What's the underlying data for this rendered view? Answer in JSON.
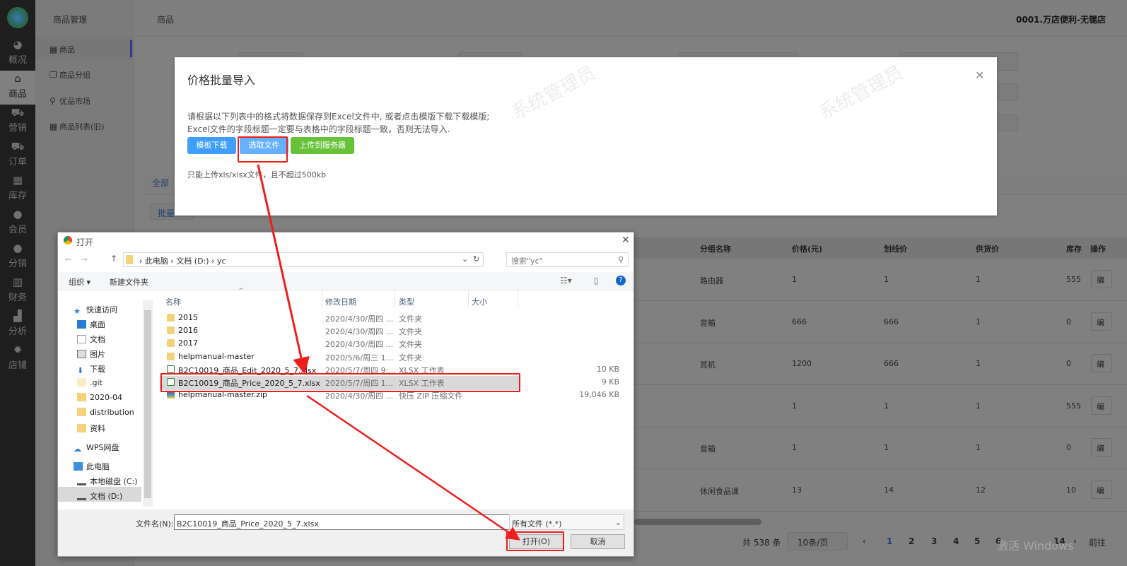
{
  "sidebar": {
    "items": [
      {
        "label": "概况",
        "icon": "dashboard-icon"
      },
      {
        "label": "商品",
        "icon": "goods-icon"
      },
      {
        "label": "营销",
        "icon": "cart-icon"
      },
      {
        "label": "订单",
        "icon": "cart-icon"
      },
      {
        "label": "库存",
        "icon": "grid-icon"
      },
      {
        "label": "会员",
        "icon": "user-icon"
      },
      {
        "label": "分销",
        "icon": "user-share-icon"
      },
      {
        "label": "财务",
        "icon": "finance-icon"
      },
      {
        "label": "分析",
        "icon": "chart-icon"
      },
      {
        "label": "店铺",
        "icon": "gear-icon"
      }
    ]
  },
  "submenu": {
    "title": "商品管理",
    "items": [
      "商品",
      "商品分组",
      "优品市场",
      "商品列表(旧)"
    ]
  },
  "header": {
    "breadcrumb": "商品",
    "store": "0001.万店便利-无锡店"
  },
  "tabs": {
    "all": "全部",
    "batch": "批量"
  },
  "table": {
    "headers": [
      "分组名称",
      "价格(元)",
      "划线价",
      "供货价",
      "库存",
      "操作"
    ],
    "rows": [
      [
        "路由器",
        "1",
        "1",
        "1",
        "555",
        "编"
      ],
      [
        "音箱",
        "666",
        "666",
        "1",
        "0",
        "编"
      ],
      [
        "耳机",
        "1200",
        "666",
        "1",
        "0",
        "编"
      ],
      [
        "",
        "1",
        "1",
        "1",
        "555",
        "编"
      ],
      [
        "音箱",
        "1",
        "1",
        "1",
        "0",
        "编"
      ],
      [
        "休闲食品课",
        "13",
        "14",
        "12",
        "10",
        "编"
      ]
    ]
  },
  "pagination": {
    "total": "共 538 条",
    "page_size": "10条/页",
    "pages": [
      "1",
      "2",
      "3",
      "4",
      "5",
      "6",
      "14"
    ],
    "goto": "前往",
    "current": "1"
  },
  "windows_watermark": "激活 Windows",
  "modal": {
    "title": "价格批量导入",
    "line1": "请根据以下列表中的格式将数据保存到Excel文件中, 或者点击模版下载下载模版;",
    "line2": "Excel文件的字段标题一定要与表格中的字段标题一致，否则无法导入.",
    "btn_template": "模板下载",
    "btn_pick": "选取文件",
    "btn_upload": "上传到服务器",
    "hint": "只能上传xls/xlsx文件，且不超过500kb",
    "watermark": "系统管理员",
    "colors": {
      "blue": "#409eff",
      "blue_light": "#66b1ff",
      "green": "#67c23a",
      "red": "#f01d1d"
    }
  },
  "file_dialog": {
    "title": "打开",
    "path": [
      "此电脑",
      "文档 (D:)",
      "yc"
    ],
    "search_placeholder": "搜索\"yc\"",
    "organize": "组织 ▾",
    "new_folder": "新建文件夹",
    "nav": [
      "快速访问",
      "桌面",
      "文档",
      "图片",
      "下载",
      ".git",
      "2020-04",
      "distribution",
      "资料",
      "WPS网盘",
      "此电脑",
      "本地磁盘 (C:)",
      "文档 (D:)"
    ],
    "columns": [
      "名称",
      "修改日期",
      "类型",
      "大小"
    ],
    "files": [
      {
        "name": "2015",
        "date": "2020/4/30/周四 ...",
        "type": "文件夹",
        "size": ""
      },
      {
        "name": "2016",
        "date": "2020/4/30/周四 ...",
        "type": "文件夹",
        "size": ""
      },
      {
        "name": "2017",
        "date": "2020/4/30/周四 ...",
        "type": "文件夹",
        "size": ""
      },
      {
        "name": "helpmanual-master",
        "date": "2020/5/6/周三 1...",
        "type": "文件夹",
        "size": ""
      },
      {
        "name": "B2C10019_商品_Edit_2020_5_7.xlsx",
        "date": "2020/5/7/周四 9:...",
        "type": "XLSX 工作表",
        "size": "10 KB"
      },
      {
        "name": "B2C10019_商品_Price_2020_5_7.xlsx",
        "date": "2020/5/7/周四 1...",
        "type": "XLSX 工作表",
        "size": "9 KB"
      },
      {
        "name": "helpmanual-master.zip",
        "date": "2020/4/30/周四 ...",
        "type": "快压 ZIP 压缩文件",
        "size": "19,046 KB"
      }
    ],
    "filename_label": "文件名(N):",
    "filename": "B2C10019_商品_Price_2020_5_7.xlsx",
    "filetype": "所有文件 (*.*)",
    "open": "打开(O)",
    "cancel": "取消"
  }
}
